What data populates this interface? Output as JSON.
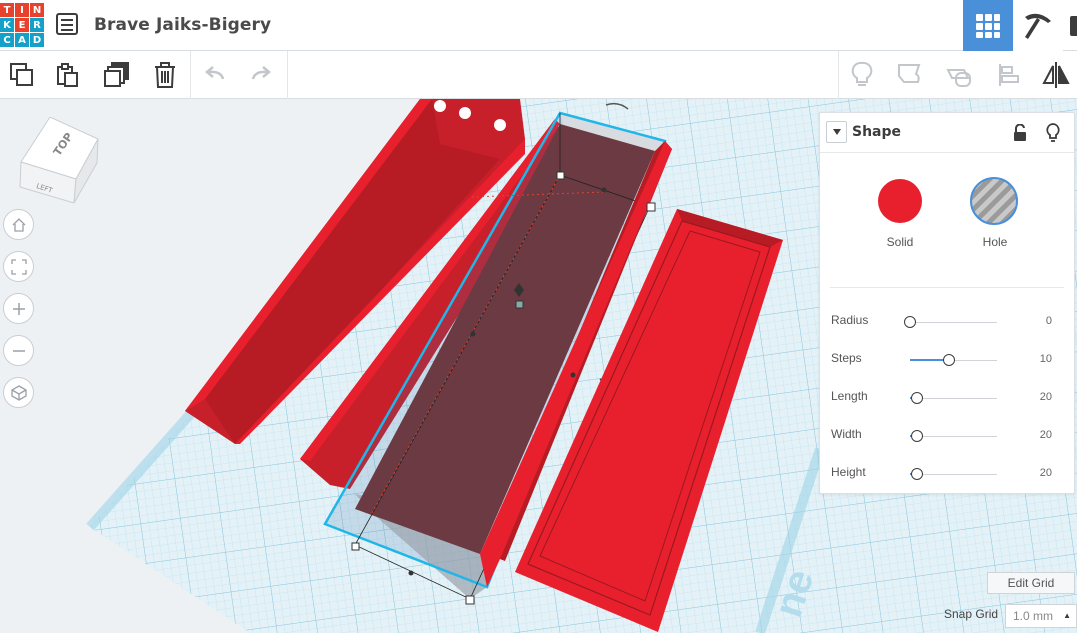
{
  "app": {
    "logo_letters": [
      "T",
      "I",
      "N",
      "K",
      "E",
      "R",
      "C",
      "A",
      "D"
    ],
    "logo_colors": [
      "#e8412c",
      "#e8412c",
      "#e8412c",
      "#14a0c8",
      "#e8412c",
      "#14a0c8",
      "#14a0c8",
      "#14a0c8",
      "#14a0c8"
    ],
    "design_title": "Brave Jaiks-Bigery"
  },
  "header": {
    "menu_icon": "list-icon",
    "view_3d_icon": "grid-icon",
    "view_build_icon": "pickaxe-icon"
  },
  "toolbar": {
    "left_icons": [
      "copy-icon",
      "paste-icon",
      "duplicate-icon",
      "trash-icon",
      "undo-icon",
      "redo-icon"
    ],
    "right_icons": [
      "lightbulb-icon",
      "notes-icon",
      "workplane-icon",
      "align-icon",
      "mirror-icon"
    ]
  },
  "viewcube": {
    "top_label": "TOP",
    "left_label": "LEFT"
  },
  "nav": [
    "home-icon",
    "fit-icon",
    "zoom-in-icon",
    "zoom-out-icon",
    "perspective-icon"
  ],
  "shape_panel": {
    "title": "Shape",
    "solid_label": "Solid",
    "hole_label": "Hole",
    "solid_color": "#e8202e",
    "properties": [
      {
        "label": "Radius",
        "value": "0",
        "fraction": 0.0
      },
      {
        "label": "Steps",
        "value": "10",
        "fraction": 0.45
      },
      {
        "label": "Length",
        "value": "20",
        "fraction": 0.08
      },
      {
        "label": "Width",
        "value": "20",
        "fraction": 0.08
      },
      {
        "label": "Height",
        "value": "20",
        "fraction": 0.08
      }
    ]
  },
  "workplane": {
    "watermark": "ne"
  },
  "bottom": {
    "edit_grid_label": "Edit Grid",
    "snap_grid_label": "Snap Grid",
    "snap_grid_value": "1.0 mm"
  },
  "colors": {
    "accent": "#4a90d9",
    "shape_red": "#e8202e",
    "grid_blue": "#9fd3e8"
  }
}
